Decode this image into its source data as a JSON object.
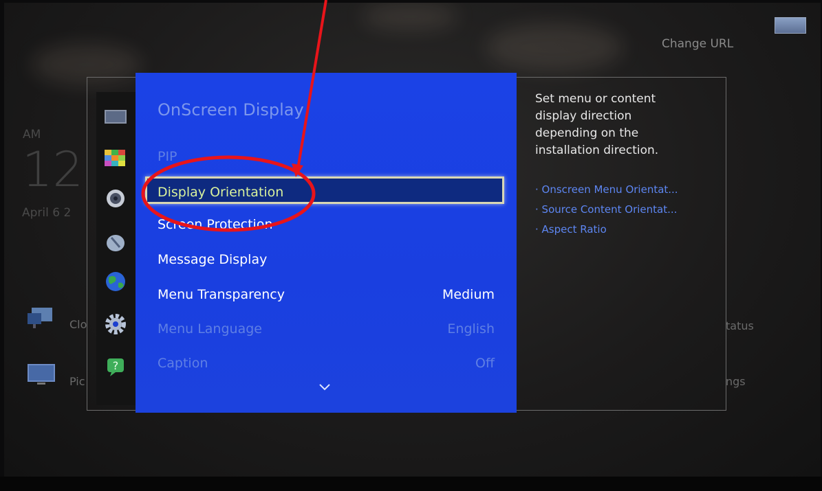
{
  "background": {
    "change_url": "Change URL",
    "time_ampm": "AM",
    "time_hour": "12",
    "date": "April 6 2",
    "tiles": [
      {
        "label": "Clo",
        "icon": "multi-screen-icon"
      },
      {
        "label": "Pic",
        "icon": "monitor-icon"
      }
    ],
    "right_labels": [
      "tatus",
      "ngs"
    ]
  },
  "sidebar_icons": [
    "picture-icon",
    "mosaic-icon",
    "speaker-icon",
    "broadcast-icon",
    "globe-icon",
    "gear-icon",
    "help-icon"
  ],
  "menu": {
    "title": "OnScreen Display",
    "items": [
      {
        "label": "PIP",
        "value": "",
        "state": "dim"
      },
      {
        "label": "Display Orientation",
        "value": "",
        "state": "selected"
      },
      {
        "label": "Screen Protection",
        "value": "",
        "state": "normal"
      },
      {
        "label": "Message Display",
        "value": "",
        "state": "normal"
      },
      {
        "label": "Menu Transparency",
        "value": "Medium",
        "state": "normal"
      },
      {
        "label": "Menu Language",
        "value": "English",
        "state": "dim"
      },
      {
        "label": "Caption",
        "value": "Off",
        "state": "dim"
      }
    ],
    "more_icon": "chevron-down-icon"
  },
  "description": {
    "text": "Set menu or content display direction depending on the installation direction.",
    "subitems": [
      "Onscreen Menu Orientat...",
      "Source Content Orientat...",
      "Aspect Ratio"
    ]
  },
  "colors": {
    "menu_blue": "#1b42e6",
    "selected_text": "#d8f19c",
    "annotation_red": "#e8141a",
    "sub_item_blue": "#5d86f2"
  }
}
